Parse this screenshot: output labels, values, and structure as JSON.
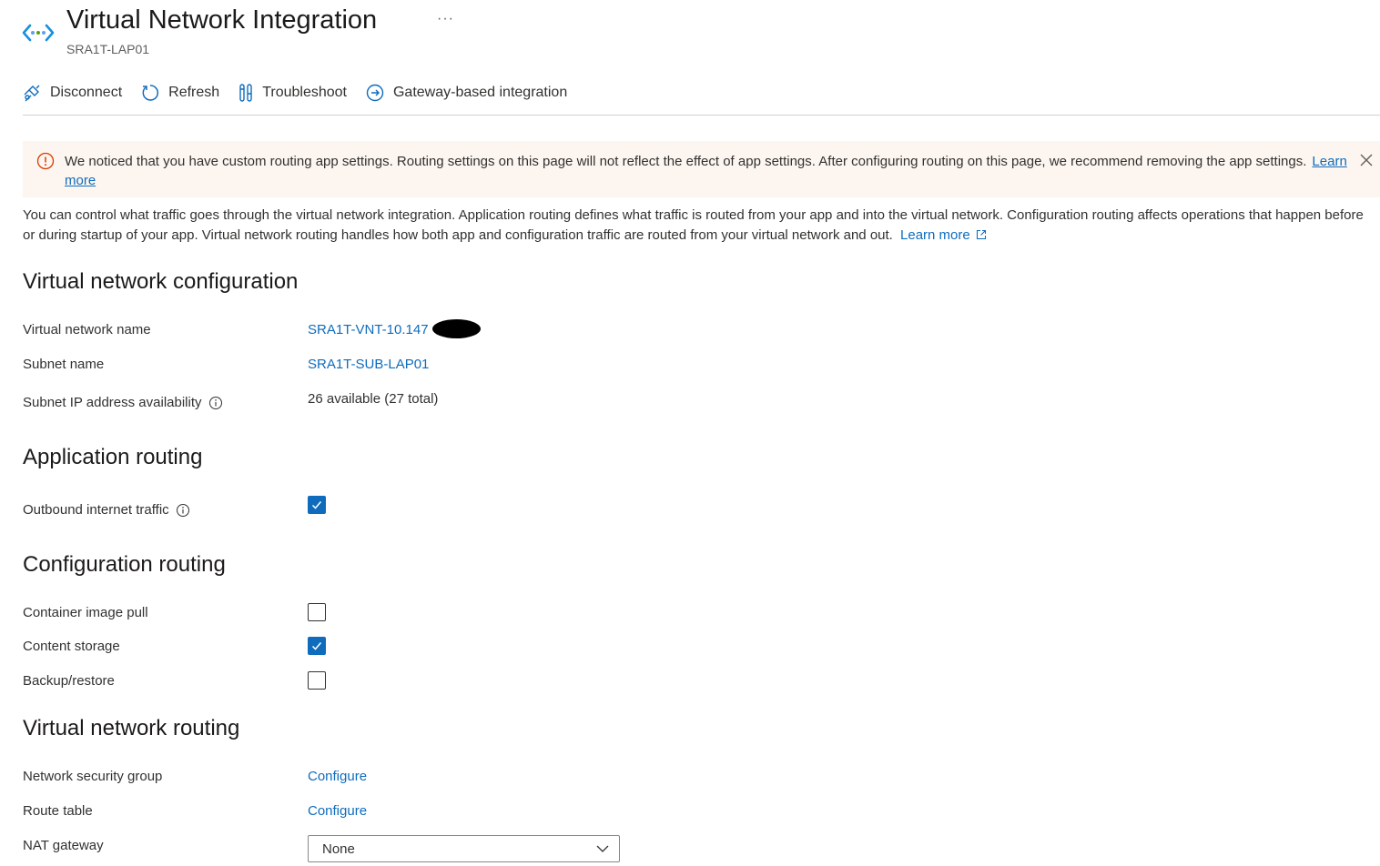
{
  "header": {
    "title": "Virtual Network Integration",
    "subtitle": "SRA1T-LAP01",
    "more": "···"
  },
  "toolbar": {
    "disconnect": "Disconnect",
    "refresh": "Refresh",
    "troubleshoot": "Troubleshoot",
    "gateway": "Gateway-based integration"
  },
  "banner": {
    "message": "We noticed that you have custom routing app settings. Routing settings on this page will not reflect the effect of app settings. After configuring routing on this page, we recommend removing the app settings.",
    "link": "Learn more"
  },
  "description": {
    "text": "You can control what traffic goes through the virtual network integration. Application routing defines what traffic is routed from your app and into the virtual network. Configuration routing affects operations that happen before or during startup of your app. Virtual network routing handles how both app and configuration traffic are routed from your virtual network and out.",
    "link": "Learn more"
  },
  "vnet_config": {
    "heading": "Virtual network configuration",
    "vnet_name_label": "Virtual network name",
    "vnet_name_value": "SRA1T-VNT-10.147",
    "subnet_label": "Subnet name",
    "subnet_value": "SRA1T-SUB-LAP01",
    "ip_label": "Subnet IP address availability",
    "ip_value": "26 available (27 total)"
  },
  "app_routing": {
    "heading": "Application routing",
    "outbound_label": "Outbound internet traffic",
    "outbound_checked": true
  },
  "config_routing": {
    "heading": "Configuration routing",
    "container_label": "Container image pull",
    "container_checked": false,
    "content_label": "Content storage",
    "content_checked": true,
    "backup_label": "Backup/restore",
    "backup_checked": false
  },
  "vnet_routing": {
    "heading": "Virtual network routing",
    "nsg_label": "Network security group",
    "nsg_value": "Configure",
    "route_label": "Route table",
    "route_value": "Configure",
    "nat_label": "NAT gateway",
    "nat_value": "None"
  },
  "colors": {
    "accent": "#0f6cbd",
    "banner_bg": "#fdf6f0",
    "warning": "#d83b01"
  }
}
